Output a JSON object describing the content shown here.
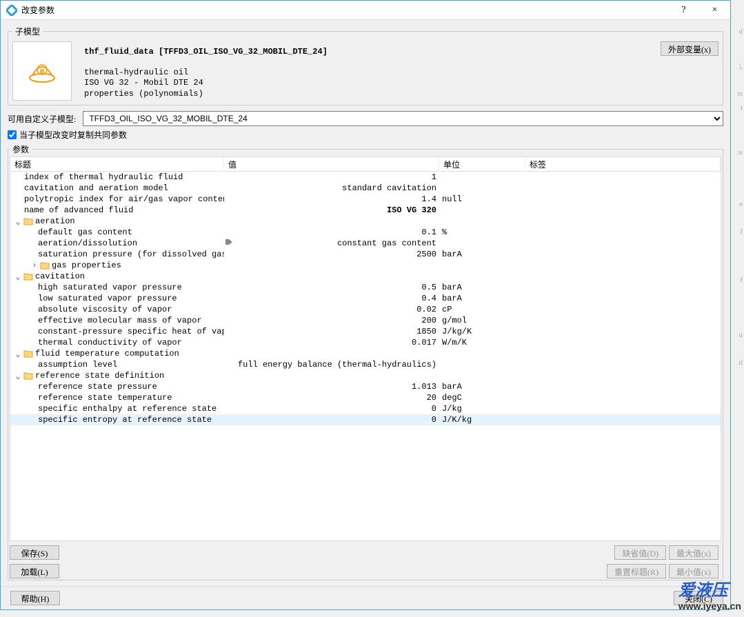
{
  "titlebar": {
    "title": "改变参数",
    "help": "?",
    "close": "×"
  },
  "submodel": {
    "legend": "子模型",
    "title": "thf_fluid_data [TFFD3_OIL_ISO_VG_32_MOBIL_DTE_24]",
    "desc1": "thermal-hydraulic oil",
    "desc2": "ISO VG 32 - Mobil DTE 24",
    "desc3": "properties (polynomials)",
    "ext_var_btn": "外部变量(x)"
  },
  "avail": {
    "label": "可用自定义子模型:",
    "selected": "TFFD3_OIL_ISO_VG_32_MOBIL_DTE_24"
  },
  "copy_check": {
    "label": "当子模型改变时复制共同参数"
  },
  "params": {
    "legend": "参数",
    "headers": {
      "title": "标题",
      "value": "值",
      "unit": "单位",
      "tag": "标签"
    },
    "rows": [
      {
        "k": "p-index",
        "indent": "indent0",
        "title": "index of thermal hydraulic fluid",
        "value": "1",
        "unit": ""
      },
      {
        "k": "p-cavmodel",
        "indent": "indent0",
        "title": "cavitation and aeration model",
        "value": "standard cavitation",
        "unit": ""
      },
      {
        "k": "p-polyidx",
        "indent": "indent0",
        "title": "polytropic index for air/gas vapor content",
        "value": "1.4",
        "unit": "null"
      },
      {
        "k": "p-advfluid",
        "indent": "indent0",
        "title": "name of advanced fluid",
        "value": "ISO VG 320",
        "unit": "",
        "bold": true
      },
      {
        "k": "g-aeration",
        "indent": "indent1",
        "group": true,
        "open": true,
        "title": "aeration"
      },
      {
        "k": "p-gas",
        "indent": "indent2",
        "title": "default gas content",
        "value": "0.1",
        "unit": "%"
      },
      {
        "k": "p-aerdiss",
        "indent": "indent2",
        "title": "aeration/dissolution",
        "value": "constant gas content",
        "unit": "",
        "pointer": true
      },
      {
        "k": "p-satpress",
        "indent": "indent2",
        "title": "saturation pressure (for dissolved gas)",
        "value": "2500",
        "unit": "barA"
      },
      {
        "k": "g-gasprop",
        "indent": "indent2g",
        "group": true,
        "open": false,
        "title": "gas properties"
      },
      {
        "k": "g-cav",
        "indent": "indent1",
        "group": true,
        "open": true,
        "title": "cavitation"
      },
      {
        "k": "p-hsvp",
        "indent": "indent2",
        "title": "high saturated vapor pressure",
        "value": "0.5",
        "unit": "barA"
      },
      {
        "k": "p-lsvp",
        "indent": "indent2",
        "title": "low saturated vapor pressure",
        "value": "0.4",
        "unit": "barA"
      },
      {
        "k": "p-avv",
        "indent": "indent2",
        "title": "absolute viscosity of vapor",
        "value": "0.02",
        "unit": "cP"
      },
      {
        "k": "p-emm",
        "indent": "indent2",
        "title": "effective molecular mass of vapor",
        "value": "200",
        "unit": "g/mol"
      },
      {
        "k": "p-cpsh",
        "indent": "indent2",
        "title": "constant-pressure specific heat of vapor",
        "value": "1850",
        "unit": "J/kg/K"
      },
      {
        "k": "p-tcv",
        "indent": "indent2",
        "title": "thermal conductivity of vapor",
        "value": "0.017",
        "unit": "W/m/K"
      },
      {
        "k": "g-ftc",
        "indent": "indent1",
        "group": true,
        "open": true,
        "title": "fluid temperature computation"
      },
      {
        "k": "p-assump",
        "indent": "indent2",
        "title": "assumption level",
        "value": "full energy balance (thermal-hydraulics)",
        "unit": ""
      },
      {
        "k": "g-rsd",
        "indent": "indent1",
        "group": true,
        "open": true,
        "title": "reference state definition"
      },
      {
        "k": "p-rsp",
        "indent": "indent2",
        "title": "reference state pressure",
        "value": "1.013",
        "unit": "barA"
      },
      {
        "k": "p-rst",
        "indent": "indent2",
        "title": "reference state temperature",
        "value": "20",
        "unit": "degC"
      },
      {
        "k": "p-sen",
        "indent": "indent2",
        "title": "specific enthalpy at reference state",
        "value": "0",
        "unit": "J/kg"
      },
      {
        "k": "p-sent",
        "indent": "indent2",
        "title": "specific entropy at reference state",
        "value": "0",
        "unit": "J/K/kg",
        "selected": true
      }
    ],
    "buttons": {
      "save": "保存(S)",
      "load": "加载(L)",
      "default": "缺省值(D)",
      "max": "最大值(x)",
      "reset": "重置标题(R)",
      "min": "最小值(x)"
    }
  },
  "footer": {
    "help": "帮助(H)",
    "close": "关闭(C)"
  },
  "watermark": {
    "cn": "爱液压",
    "url": "www.iyeya.cn"
  }
}
